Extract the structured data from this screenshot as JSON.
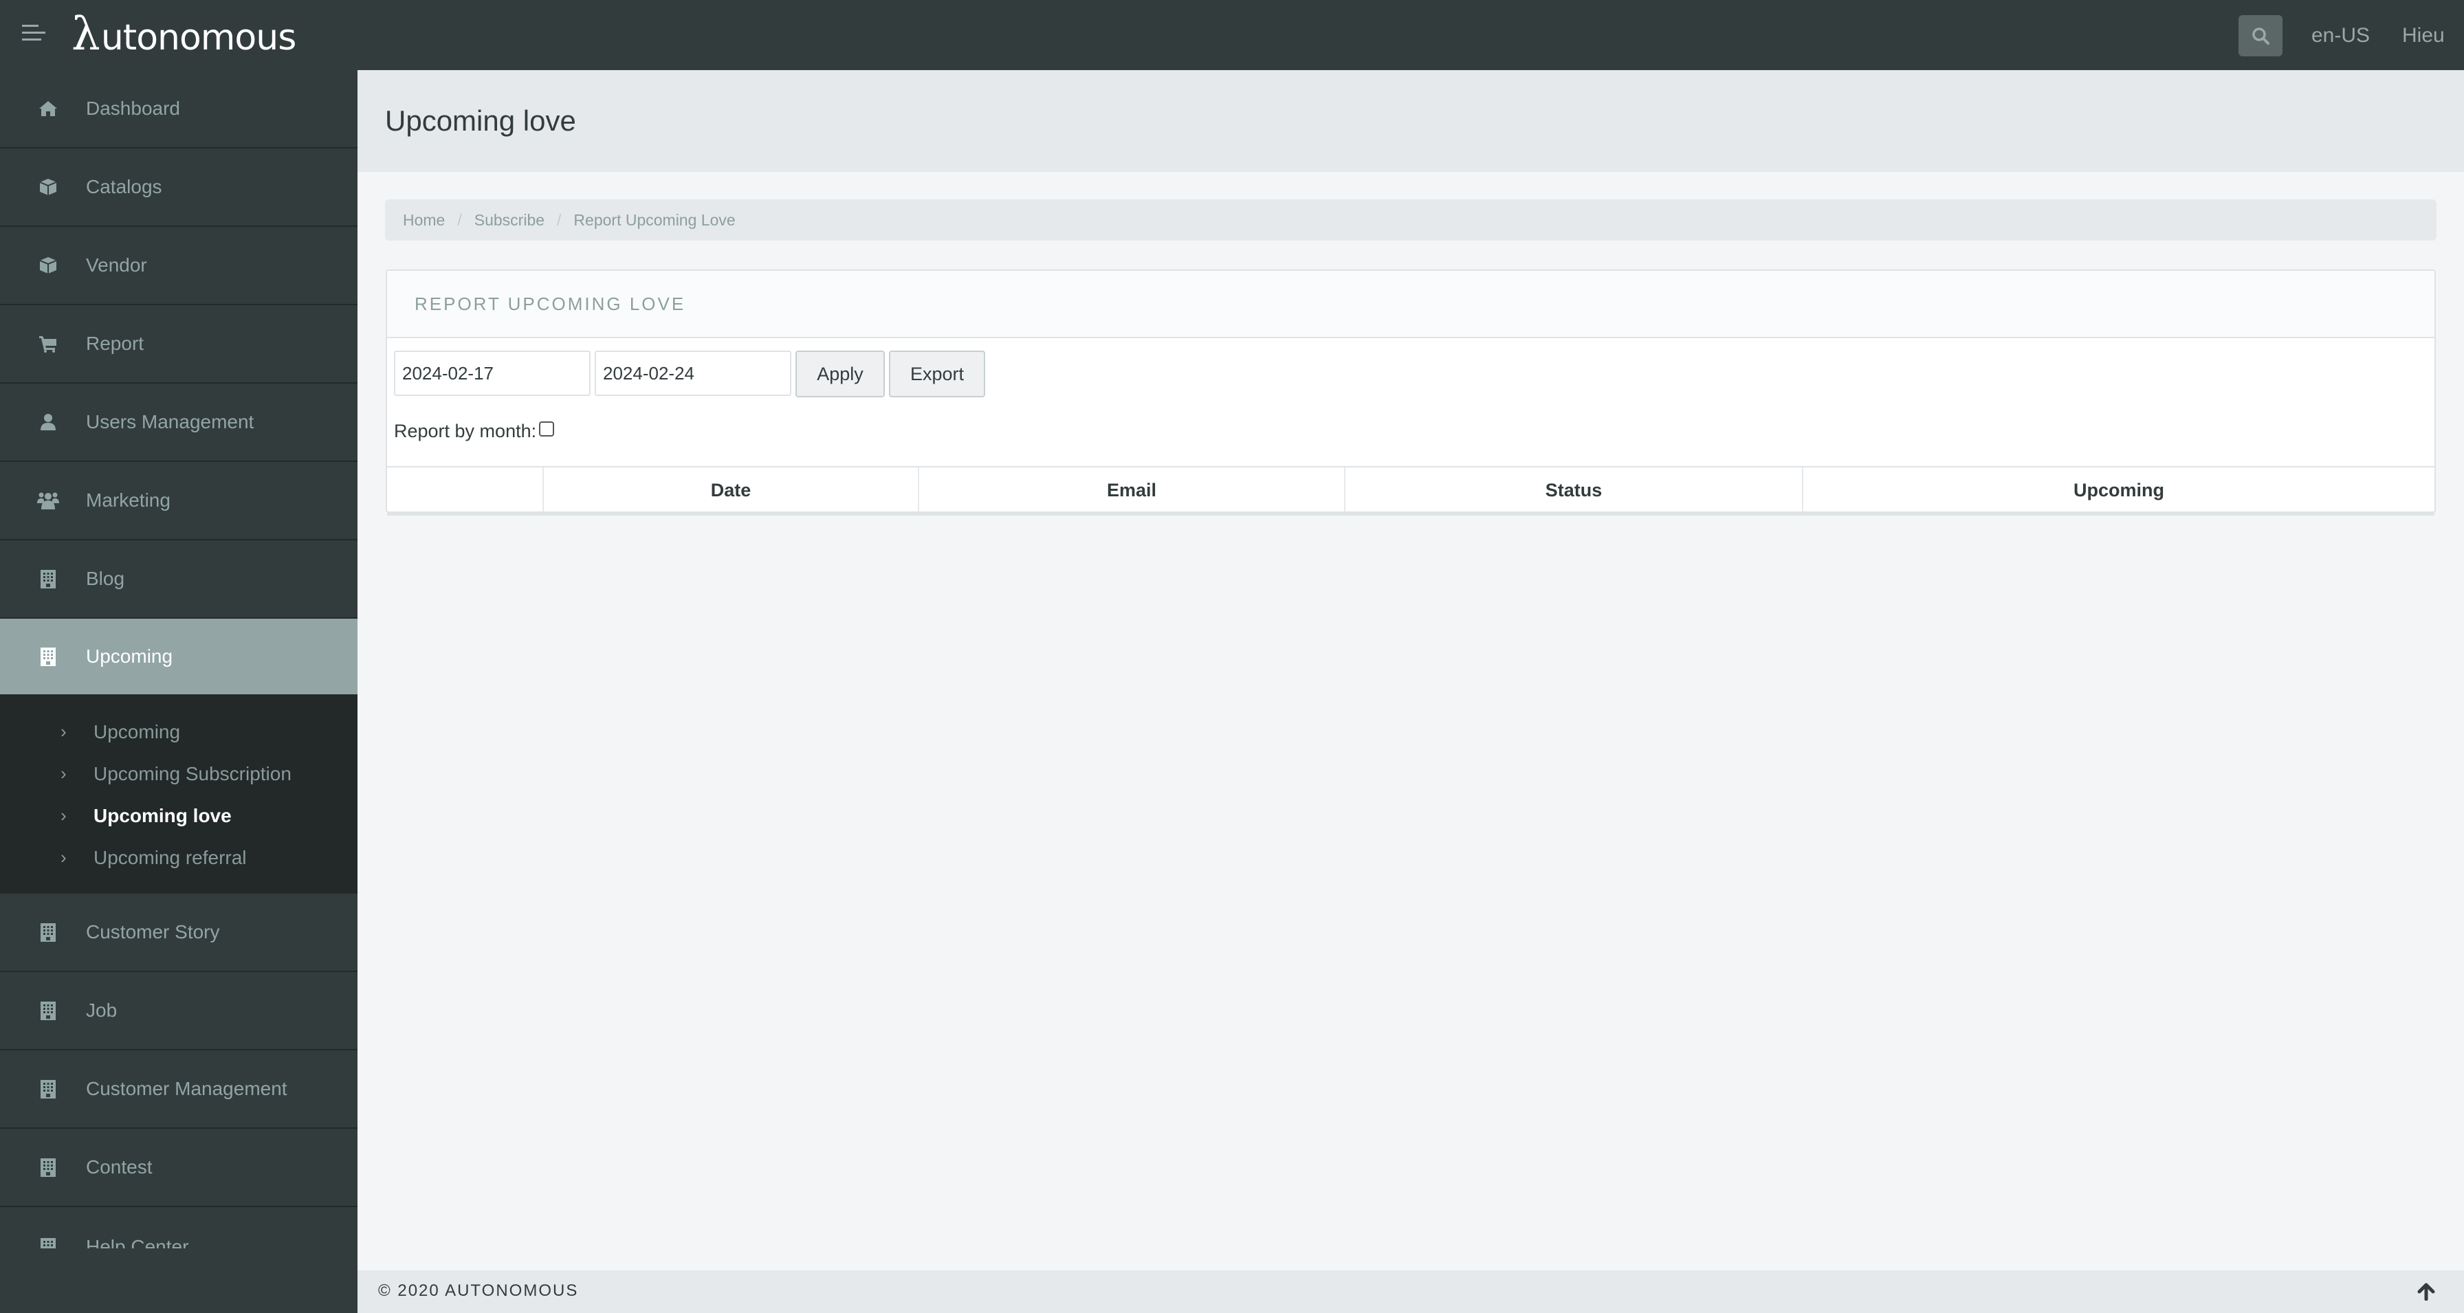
{
  "header": {
    "brand_lambda": "λ",
    "brand_rest": "utonomous",
    "language": "en-US",
    "user": "Hieu"
  },
  "sidebar": {
    "items": [
      {
        "label": "Dashboard",
        "icon": "home-icon"
      },
      {
        "label": "Catalogs",
        "icon": "cube-icon"
      },
      {
        "label": "Vendor",
        "icon": "cube-icon"
      },
      {
        "label": "Report",
        "icon": "cart-icon"
      },
      {
        "label": "Users Management",
        "icon": "user-icon"
      },
      {
        "label": "Marketing",
        "icon": "users-icon"
      },
      {
        "label": "Blog",
        "icon": "building-icon"
      },
      {
        "label": "Upcoming",
        "icon": "building-icon",
        "active": true
      },
      {
        "label": "Customer Story",
        "icon": "building-icon"
      },
      {
        "label": "Job",
        "icon": "building-icon"
      },
      {
        "label": "Customer Management",
        "icon": "building-icon"
      },
      {
        "label": "Contest",
        "icon": "building-icon"
      },
      {
        "label": "Help Center",
        "icon": "building-icon"
      }
    ],
    "submenu": [
      {
        "label": "Upcoming"
      },
      {
        "label": "Upcoming Subscription"
      },
      {
        "label": "Upcoming love",
        "current": true
      },
      {
        "label": "Upcoming referral"
      }
    ]
  },
  "page": {
    "title": "Upcoming love",
    "breadcrumb": [
      "Home",
      "Subscribe",
      "Report Upcoming Love"
    ],
    "breadcrumb_sep": "/"
  },
  "panel": {
    "heading": "REPORT UPCOMING LOVE",
    "date_from": "2024-02-17",
    "date_to": "2024-02-24",
    "apply_label": "Apply",
    "export_label": "Export",
    "report_by_month_label": "Report by month:",
    "report_by_month_checked": false,
    "columns": [
      "",
      "Date",
      "Email",
      "Status",
      "Upcoming"
    ]
  },
  "footer": {
    "copyright": "© 2020 AUTONOMOUS"
  }
}
